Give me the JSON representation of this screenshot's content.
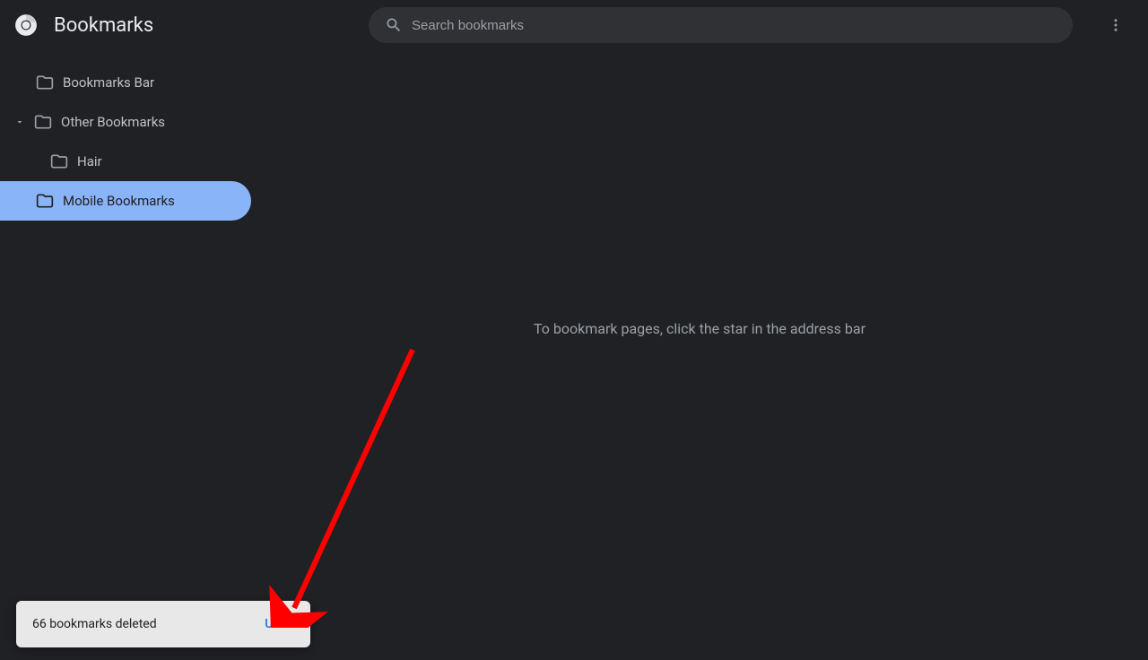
{
  "header": {
    "title": "Bookmarks",
    "search_placeholder": "Search bookmarks"
  },
  "sidebar": {
    "items": [
      {
        "label": "Bookmarks Bar",
        "expandable": false,
        "indent": 0,
        "selected": false
      },
      {
        "label": "Other Bookmarks",
        "expandable": true,
        "expanded": true,
        "indent": 0,
        "selected": false
      },
      {
        "label": "Hair",
        "expandable": false,
        "indent": 1,
        "selected": false
      },
      {
        "label": "Mobile Bookmarks",
        "expandable": false,
        "indent": 0,
        "selected": true
      }
    ]
  },
  "main": {
    "empty_message": "To bookmark pages, click the star in the address bar"
  },
  "toast": {
    "message": "66 bookmarks deleted",
    "action": "Undo"
  },
  "annotation": {
    "arrow_color": "#ff0000"
  }
}
